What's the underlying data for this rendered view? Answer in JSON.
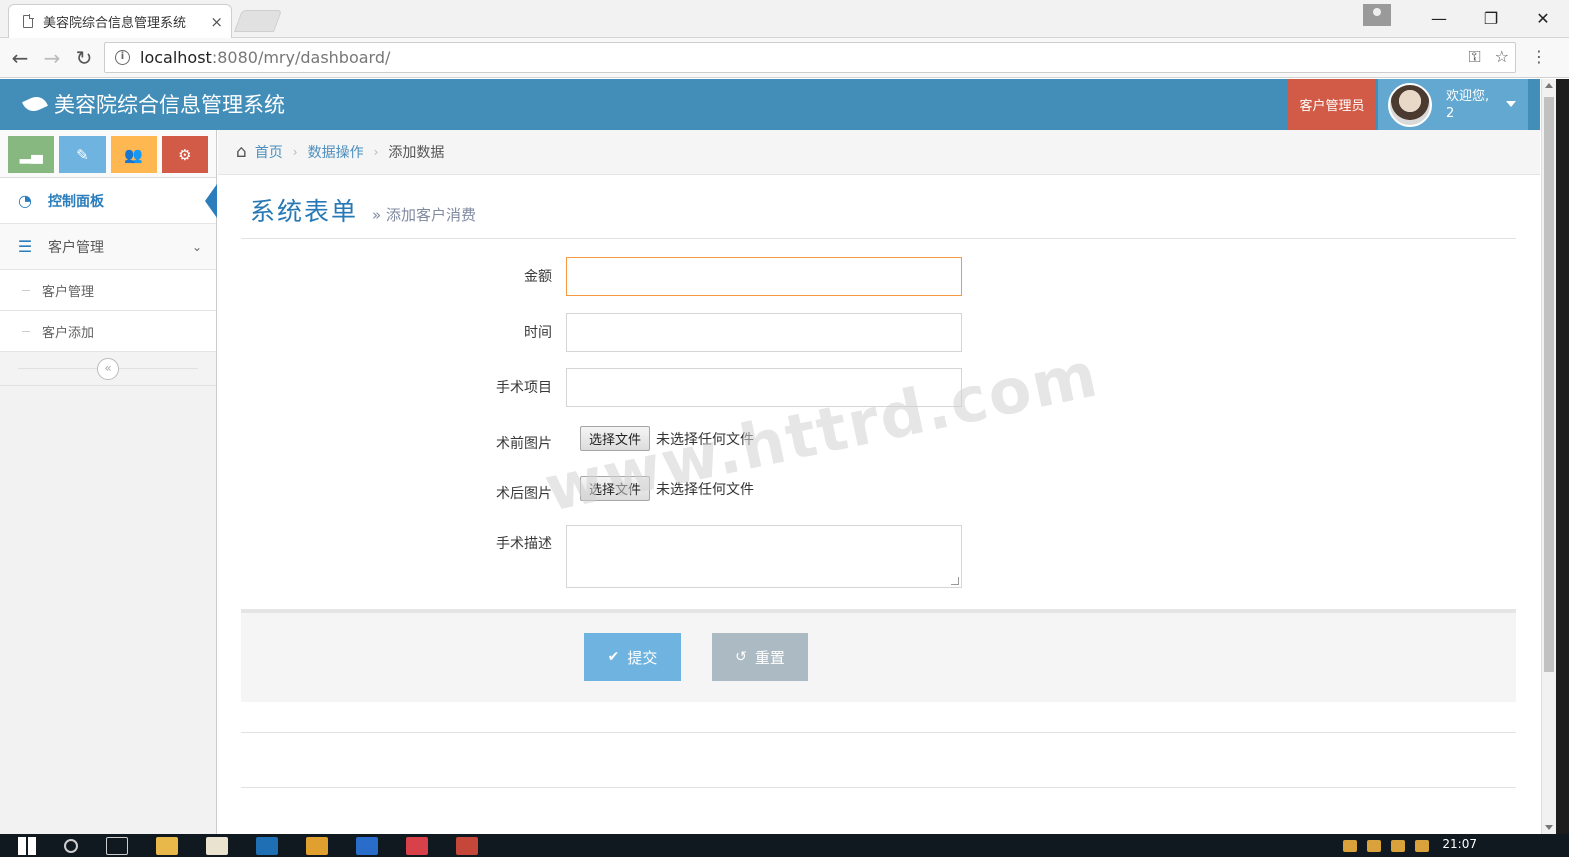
{
  "browser": {
    "tab_title": "美容院综合信息管理系统",
    "tab_close": "×",
    "url_host": "localhost",
    "url_rest": ":8080/mry/dashboard/",
    "back": "←",
    "forward": "→",
    "reload": "↻",
    "minimize": "—",
    "restore": "❐",
    "close": "✕",
    "key_icon": "⚿",
    "star_icon": "☆",
    "menu_icon": "⋮"
  },
  "header": {
    "brand": "美容院综合信息管理系统",
    "role": "客户管理员",
    "welcome_line1": "欢迎您,",
    "welcome_line2": "2"
  },
  "sidebar": {
    "shortcuts": [
      {
        "icon": "signal-icon",
        "glyph": "▂▄",
        "color": "#87b87f"
      },
      {
        "icon": "pencil-icon",
        "glyph": "✎",
        "color": "#6fb3e0"
      },
      {
        "icon": "users-icon",
        "glyph": "👥",
        "color": "#ffb752"
      },
      {
        "icon": "cogs-icon",
        "glyph": "⚙",
        "color": "#d15b47"
      }
    ],
    "items": [
      {
        "label": "控制面板",
        "icon_glyph": "◔",
        "active": true
      },
      {
        "label": "客户管理",
        "icon_glyph": "☰",
        "expanded": true,
        "chevron": "⌄"
      }
    ],
    "sub_items": [
      {
        "label": "客户管理"
      },
      {
        "label": "客户添加"
      }
    ],
    "collapse_glyph": "«"
  },
  "breadcrumb": {
    "home_icon": "⌂",
    "items": [
      "首页",
      "数据操作",
      "添加数据"
    ],
    "sep": "›"
  },
  "page": {
    "title": "系统表单",
    "subtitle": "» 添加客户消费"
  },
  "form": {
    "amount_label": "金额",
    "amount_value": "",
    "time_label": "时间",
    "time_value": "",
    "project_label": "手术项目",
    "project_value": "",
    "before_label": "术前图片",
    "after_label": "术后图片",
    "file_button": "选择文件",
    "file_status": "未选择任何文件",
    "desc_label": "手术描述",
    "submit": "提交",
    "submit_icon": "✔",
    "reset": "重置",
    "reset_icon": "↺"
  },
  "watermark": "www.httrd.com",
  "taskbar": {
    "time": "21:07"
  },
  "colors": {
    "header": "#438eb9",
    "role_badge": "#d15b47",
    "submit": "#6fb3e0",
    "reset": "#abbac3",
    "focus": "#f59942"
  }
}
